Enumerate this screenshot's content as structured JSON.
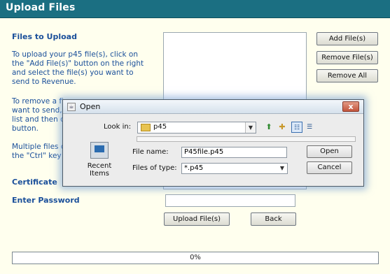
{
  "window": {
    "title": "Upload Files"
  },
  "left": {
    "files_heading": "Files to Upload",
    "para1": "To upload your p45 file(s), click on the \"Add File(s)\" button on the right and select the file(s) you want to send to Revenue.",
    "para2_lines": [
      "To remove a fi",
      "want to send, s",
      "list and then cl",
      "button."
    ],
    "para3_lines": [
      "Multiple files c",
      "the \"Ctrl\" key o"
    ],
    "certificate_heading": "Certificate",
    "password_heading": "Enter Password"
  },
  "buttons": {
    "add": "Add File(s)",
    "remove": "Remove File(s)",
    "remove_all": "Remove All",
    "upload": "Upload File(s)",
    "back": "Back"
  },
  "password": {
    "value": ""
  },
  "progress": {
    "label": "0%",
    "fraction": 0
  },
  "dialog": {
    "title": "Open",
    "close_label": "x",
    "look_in_label": "Look in:",
    "look_in_value": "p45",
    "recent_items": "Recent Items",
    "file_name_label": "File name:",
    "file_name_value": "P45file.p45",
    "files_of_type_label": "Files of type:",
    "files_of_type_value": "*.p45",
    "open_button": "Open",
    "cancel_button": "Cancel"
  },
  "icons": {
    "up_folder": "up-folder-icon",
    "new_folder": "new-folder-icon",
    "list_view": "list-view-icon",
    "details_view": "details-view-icon"
  },
  "colors": {
    "title_bar": "#1b6f82",
    "text": "#1a4f9a",
    "background": "#ffffee"
  }
}
